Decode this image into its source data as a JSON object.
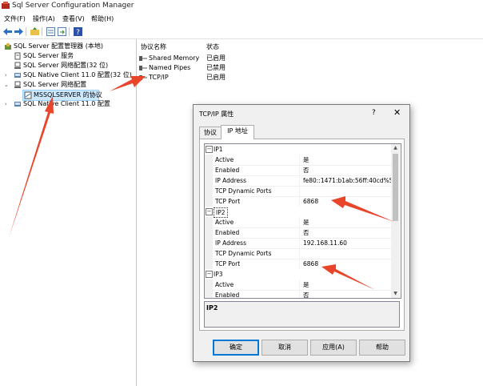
{
  "window": {
    "title": "Sql Server Configuration Manager"
  },
  "menu": [
    "文件(F)",
    "操作(A)",
    "查看(V)",
    "帮助(H)"
  ],
  "toolbar": {
    "icons": [
      "back-arrow-icon",
      "forward-arrow-icon",
      "up-folder-icon",
      "properties-icon",
      "export-icon",
      "help-icon"
    ]
  },
  "tree": {
    "items": [
      {
        "label": "SQL Server 配置管理器 (本地)",
        "icon": "config-manager-icon"
      },
      {
        "label": "SQL Server 服务",
        "icon": "services-icon"
      },
      {
        "label": "SQL Server 网络配置(32 位)",
        "icon": "network-icon"
      },
      {
        "label": "SQL Native Client 11.0 配置(32 位)",
        "icon": "client-icon"
      },
      {
        "label": "SQL Server 网络配置",
        "icon": "network-icon"
      },
      {
        "label": "MSSQLSERVER 的协议",
        "icon": "protocols-icon"
      },
      {
        "label": "SQL Native Client 11.0 配置",
        "icon": "client-icon"
      }
    ]
  },
  "list": {
    "columns": [
      "协议名称",
      "状态"
    ],
    "rows": [
      {
        "name": "Shared Memory",
        "status": "已启用"
      },
      {
        "name": "Named Pipes",
        "status": "已禁用"
      },
      {
        "name": "TCP/IP",
        "status": "已启用"
      }
    ]
  },
  "dialog": {
    "title": "TCP/IP 属性",
    "help": "?",
    "close": "✕",
    "tabs": [
      "协议",
      "IP 地址"
    ],
    "sections": [
      {
        "name": "IP1",
        "props": [
          {
            "k": "Active",
            "v": "是"
          },
          {
            "k": "Enabled",
            "v": "否"
          },
          {
            "k": "IP Address",
            "v": "fe80::1471:b1ab:56ff:40cd%5"
          },
          {
            "k": "TCP Dynamic Ports",
            "v": ""
          },
          {
            "k": "TCP Port",
            "v": "6868"
          }
        ]
      },
      {
        "name": "IP2",
        "props": [
          {
            "k": "Active",
            "v": "是"
          },
          {
            "k": "Enabled",
            "v": "否"
          },
          {
            "k": "IP Address",
            "v": "192.168.11.60"
          },
          {
            "k": "TCP Dynamic Ports",
            "v": ""
          },
          {
            "k": "TCP Port",
            "v": "6868"
          }
        ]
      },
      {
        "name": "IP3",
        "props": [
          {
            "k": "Active",
            "v": "是"
          },
          {
            "k": "Enabled",
            "v": "否"
          }
        ]
      }
    ],
    "description_title": "IP2",
    "buttons": {
      "ok": "确定",
      "cancel": "取消",
      "apply": "应用(A)",
      "help": "帮助"
    }
  },
  "colors": {
    "annotation_arrow": "#e8452b",
    "selection": "#cce8ff",
    "dialog_bg": "#f0f0f0"
  }
}
